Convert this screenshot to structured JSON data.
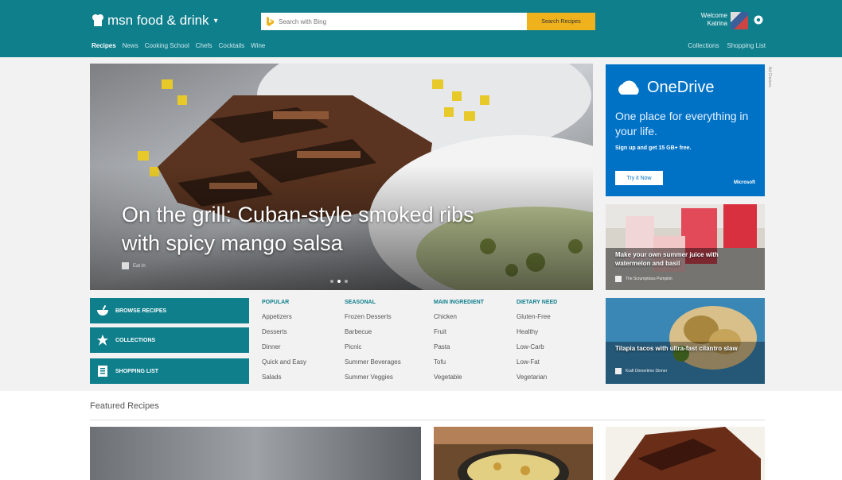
{
  "header": {
    "brand": "msn food & drink",
    "search_placeholder": "Search with Bing",
    "search_button": "Search Recipes",
    "welcome_line1": "Welcome",
    "welcome_line2": "Katrina",
    "icons": {
      "brand": "chef-hat-icon",
      "search": "bing-logo-icon",
      "settings": "gear-icon"
    },
    "colors": {
      "bar": "#0f7f8c",
      "search_button": "#f0b21c"
    }
  },
  "nav": {
    "items": [
      "Recipes",
      "News",
      "Cooking School",
      "Chefs",
      "Cocktails",
      "Wine"
    ],
    "right_items": [
      "Collections",
      "Shopping List"
    ]
  },
  "hero": {
    "title": "On the grill: Cuban-style smoked ribs with spicy mango salsa",
    "source": "Eat In"
  },
  "ad": {
    "brand": "OneDrive",
    "tagline": "One place for everything in your life.",
    "subline": "Sign up and get 15 GB+ free.",
    "button": "Try it Now",
    "advertiser": "Microsoft",
    "label": "Ad Choices",
    "colors": {
      "bg": "#0072c6"
    }
  },
  "side_cards": [
    {
      "title": "Make your own summer juice with watermelon and basil",
      "source": "The Scrumptious Pumpkin"
    },
    {
      "title": "Tilapia tacos with ultra-fast cilantro slaw",
      "source": "Kraft Dinnertime Dinner"
    }
  ],
  "actions": [
    {
      "label": "BROWSE RECIPES",
      "icon": "bowl-icon"
    },
    {
      "label": "COLLECTIONS",
      "icon": "star-icon"
    },
    {
      "label": "SHOPPING LIST",
      "icon": "list-icon"
    }
  ],
  "categories": [
    {
      "heading": "POPULAR",
      "items": [
        "Appetizers",
        "Desserts",
        "Dinner",
        "Quick and Easy",
        "Salads"
      ]
    },
    {
      "heading": "SEASONAL",
      "items": [
        "Frozen Desserts",
        "Barbecue",
        "Picnic",
        "Summer Beverages",
        "Summer Veggies"
      ]
    },
    {
      "heading": "MAIN INGREDIENT",
      "items": [
        "Chicken",
        "Fruit",
        "Pasta",
        "Tofu",
        "Vegetable"
      ]
    },
    {
      "heading": "DIETARY NEED",
      "items": [
        "Gluten-Free",
        "Healthy",
        "Low-Carb",
        "Low-Fat",
        "Vegetarian"
      ]
    }
  ],
  "featured": {
    "heading": "Featured Recipes"
  }
}
